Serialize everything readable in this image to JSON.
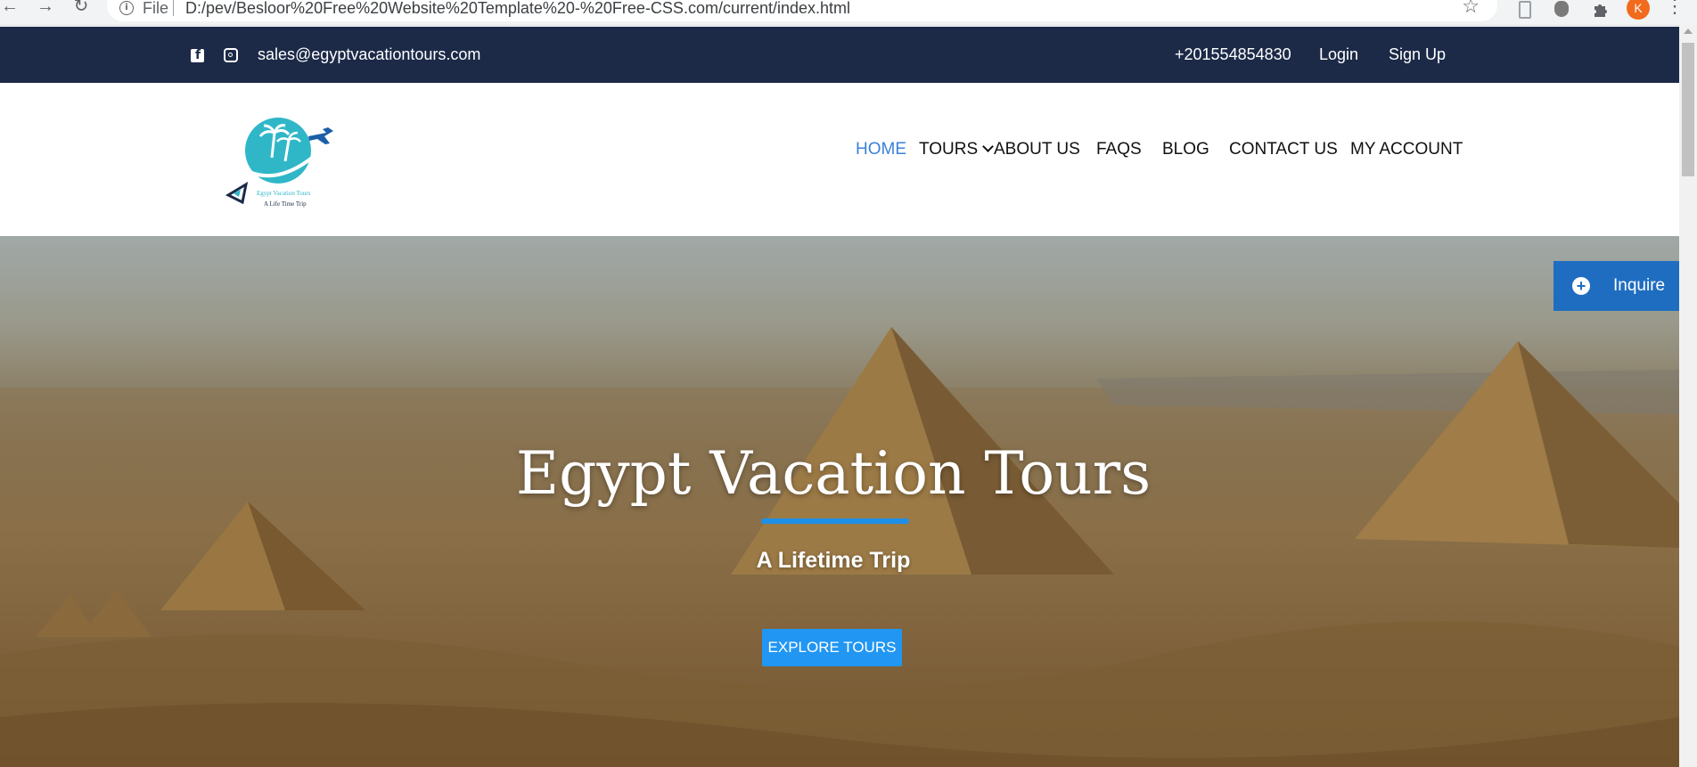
{
  "browser": {
    "back": "←",
    "forward": "→",
    "reload": "↻",
    "info": "i",
    "file_label": "File",
    "url": "D:/pev/Besloor%20Free%20Website%20Template%20-%20Free-CSS.com/current/index.html",
    "star": "☆",
    "avatar_initial": "K",
    "menu": "⋮"
  },
  "topbar": {
    "email": "sales@egyptvacationtours.com",
    "phone": "+201554854830",
    "login": "Login",
    "signup": "Sign Up",
    "facebook_glyph": "f"
  },
  "logo": {
    "brand": "Egypt Vacation Tours",
    "tagline": "A Life Time Trip"
  },
  "nav": {
    "home": "HOME",
    "tours": "TOURS",
    "about": "ABOUT US",
    "faqs": "FAQS",
    "blog": "BLOG",
    "contact": "CONTACT US",
    "account": "MY ACCOUNT"
  },
  "hero": {
    "title": "Egypt Vacation Tours",
    "subtitle": "A Lifetime Trip",
    "button": "EXPLORE TOURS"
  },
  "inquire": {
    "label": "Inquire",
    "plus": "+"
  },
  "colors": {
    "topbar": "#1c2a48",
    "accent": "#2196f3",
    "nav_active": "#3b82d6",
    "inquire": "#1f6dc0"
  }
}
